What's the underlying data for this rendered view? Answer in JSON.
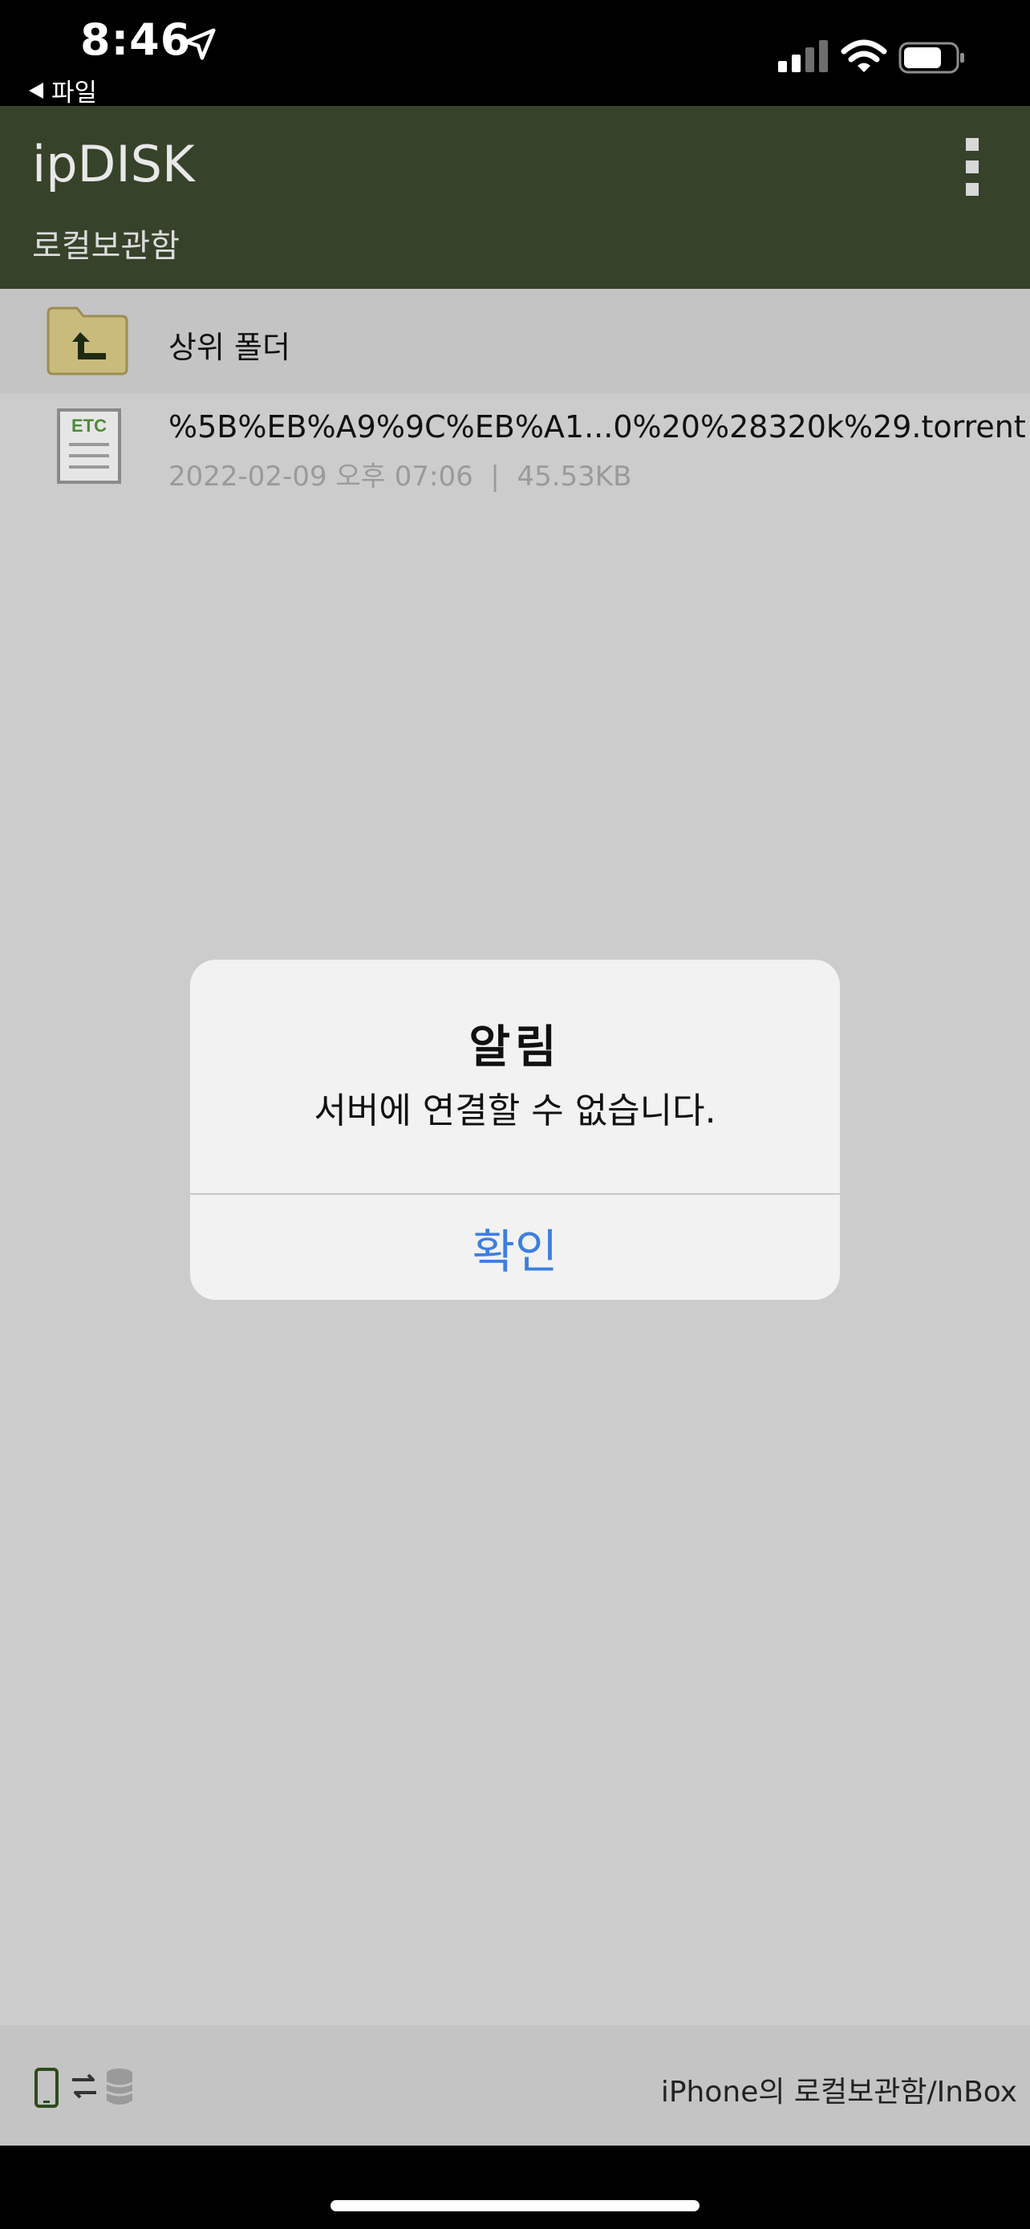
{
  "status_bar": {
    "time": "8:46",
    "back_label": "파일",
    "icons": [
      "location-arrow-icon",
      "cellular-signal-icon",
      "wifi-icon",
      "battery-icon"
    ]
  },
  "header": {
    "title": "ipDISK",
    "subtitle": "로컬보관함",
    "menu_icon": "more-vertical-icon",
    "background_color": "#37422a"
  },
  "file_list": {
    "parent_folder": {
      "label": "상위 폴더",
      "icon": "folder-up-icon"
    },
    "files": [
      {
        "icon_label": "ETC",
        "name": "%5B%EB%A9%9C%EB%A1...0%20%28320k%29.torrent",
        "meta": "2022-02-09 오후 07:06  |  45.53KB"
      }
    ]
  },
  "bottom_bar": {
    "path": "iPhone의 로컬보관함/InBox",
    "icons": [
      "phone-icon",
      "transfer-arrows-icon",
      "database-icon"
    ]
  },
  "alert": {
    "title": "알림",
    "message": "서버에 연결할 수 없습니다.",
    "confirm_label": "확인",
    "button_color": "#3d7fe0"
  }
}
